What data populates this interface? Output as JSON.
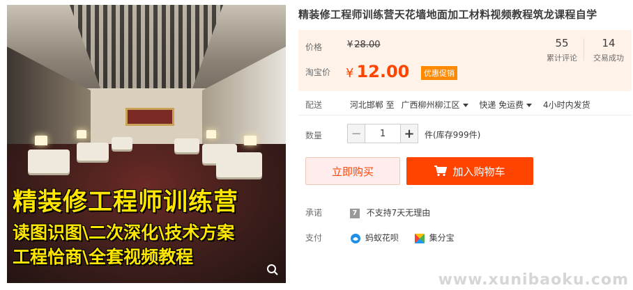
{
  "product": {
    "title": "精装修工程师训练营天花墙地面加工材料视频教程筑龙课程自学",
    "image_text": {
      "line1": "精装修工程师训练营",
      "line2": "读图识图\\二次深化\\技术方案",
      "line3": "工程恰商\\全套视频教程"
    }
  },
  "price": {
    "label": "价格",
    "currency": "¥",
    "original": "28.00",
    "taobao_label": "淘宝价",
    "current": "12.00",
    "promo_badge": "优惠促销"
  },
  "stats": {
    "reviews_count": "55",
    "reviews_label": "累计评论",
    "sales_count": "14",
    "sales_label": "交易成功"
  },
  "delivery": {
    "label": "配送",
    "from": "河北邯郸 至",
    "to": "广西柳州柳江区",
    "method": "快递 免运费",
    "ship_time": "4小时内发货"
  },
  "quantity": {
    "label": "数量",
    "minus": "−",
    "value": "1",
    "plus": "+",
    "stock_text": "件(库存999件)"
  },
  "actions": {
    "buy_now": "立即购买",
    "add_to_cart": "加入购物车"
  },
  "promise": {
    "label": "承诺",
    "icon_char": "7",
    "text": "不支持7天无理由"
  },
  "payment": {
    "label": "支付",
    "methods": [
      "蚂蚁花呗",
      "集分宝"
    ]
  },
  "watermark": "www.xunibaoku.com",
  "colors": {
    "accent": "#ff4400",
    "price_bg": "#fff2e8",
    "promo": "#ff8a00"
  }
}
